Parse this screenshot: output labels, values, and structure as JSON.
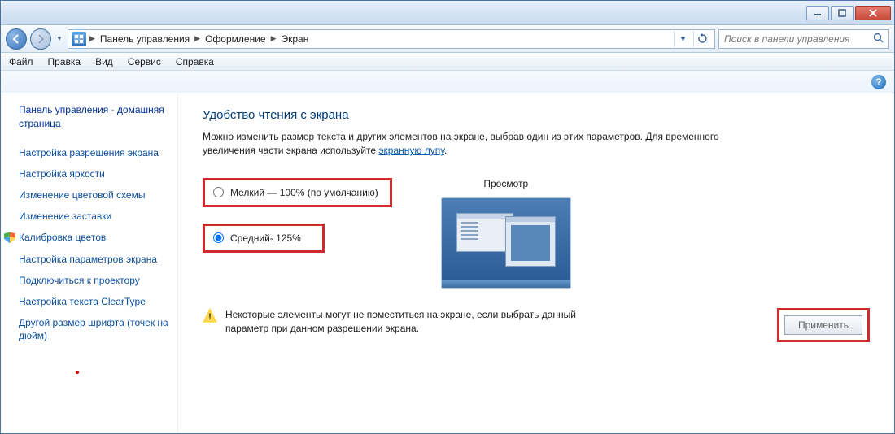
{
  "breadcrumb": {
    "items": [
      "Панель управления",
      "Оформление",
      "Экран"
    ]
  },
  "search": {
    "placeholder": "Поиск в панели управления"
  },
  "menubar": [
    "Файл",
    "Правка",
    "Вид",
    "Сервис",
    "Справка"
  ],
  "sidebar": {
    "home": "Панель управления - домашняя страница",
    "links": [
      "Настройка разрешения экрана",
      "Настройка яркости",
      "Изменение цветовой схемы",
      "Изменение заставки",
      "Калибровка цветов",
      "Настройка параметров экрана",
      "Подключиться к проектору",
      "Настройка текста ClearType",
      "Другой размер шрифта (точек на дюйм)"
    ]
  },
  "main": {
    "title": "Удобство чтения с экрана",
    "intro1": "Можно изменить размер текста и других элементов на экране, выбрав один из этих параметров. Для временного увеличения части экрана используйте ",
    "intro_link": "экранную лупу",
    "intro2": ".",
    "option_small": "Мелкий — 100% (по умолчанию)",
    "option_medium": "Средний- 125%",
    "preview_label": "Просмотр",
    "warning": "Некоторые элементы могут не поместиться на экране, если выбрать данный параметр при данном разрешении экрана.",
    "apply": "Применить"
  }
}
